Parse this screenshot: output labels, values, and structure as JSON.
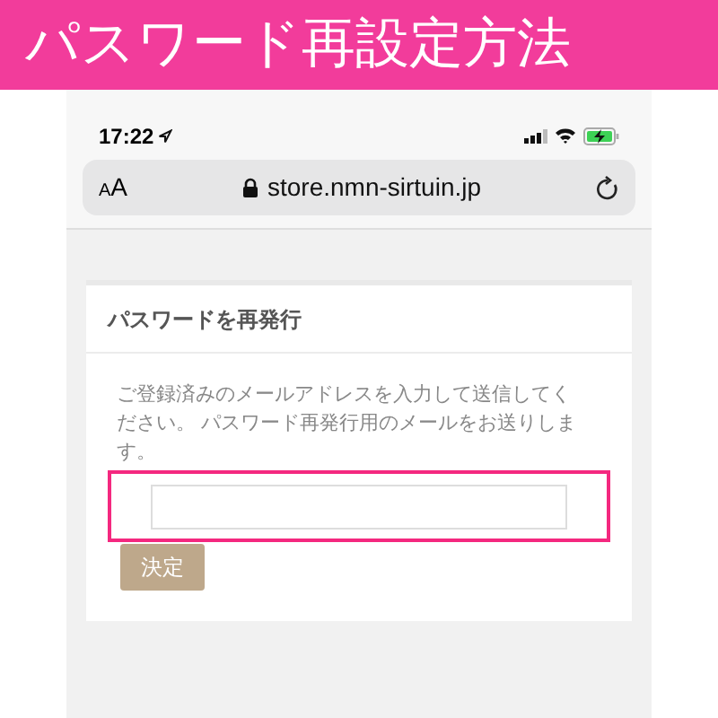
{
  "banner": {
    "title": "パスワード再設定方法"
  },
  "status_bar": {
    "time": "17:22"
  },
  "address_bar": {
    "text_size": "AA",
    "url": "store.nmn-sirtuin.jp"
  },
  "card": {
    "title": "パスワードを再発行",
    "instructions": "ご登録済みのメールアドレスを入力して送信してください。 パスワード再発行用のメールをお送りします。",
    "submit_button": "決定",
    "highlighted": true
  }
}
